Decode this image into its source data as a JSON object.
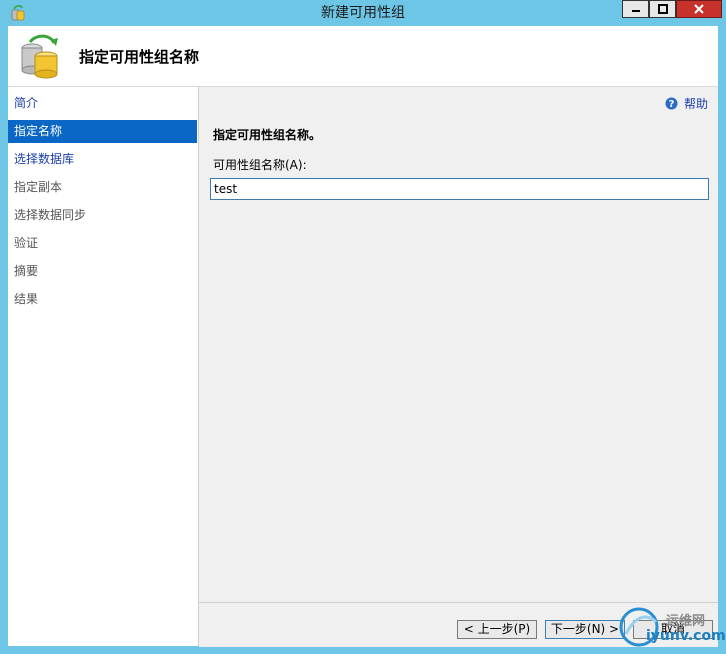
{
  "window": {
    "title": "新建可用性组",
    "controls": [
      "minimize-icon",
      "maximize-icon",
      "close-icon"
    ]
  },
  "header": {
    "title": "指定可用性组名称",
    "icon": "database-sync-icon"
  },
  "nav": {
    "items": [
      {
        "label": "简介",
        "state": "link"
      },
      {
        "label": "指定名称",
        "state": "active"
      },
      {
        "label": "选择数据库",
        "state": "link"
      },
      {
        "label": "指定副本",
        "state": "disabled"
      },
      {
        "label": "选择数据同步",
        "state": "disabled"
      },
      {
        "label": "验证",
        "state": "disabled"
      },
      {
        "label": "摘要",
        "state": "disabled"
      },
      {
        "label": "结果",
        "state": "disabled"
      }
    ]
  },
  "content": {
    "help_label": "帮助",
    "help_icon": "help-icon",
    "instruction": "指定可用性组名称。",
    "field_label": "可用性组名称(A):",
    "field_value": "test"
  },
  "footer": {
    "prev_label": "< 上一步(P)",
    "next_label": "下一步(N) >",
    "cancel_label": "取消"
  },
  "watermark": {
    "line1": "运维网",
    "line2": "iyunv.com"
  },
  "colors": {
    "titlebar": "#6ec6e6",
    "active_nav": "#0a67c6",
    "link": "#1a3ea8",
    "close_button": "#c7312b"
  }
}
